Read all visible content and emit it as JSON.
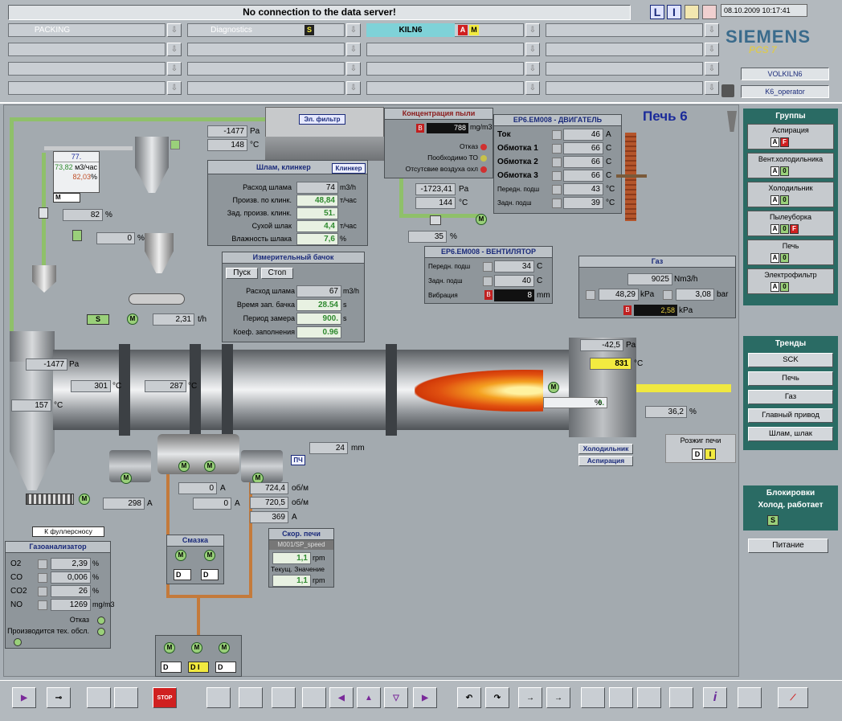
{
  "header": {
    "message": "No connection to the data server!",
    "datetime": "08.10.2009 10:17:41",
    "areas": [
      {
        "label": "PACKING"
      },
      {
        "label": "Diagnostics",
        "badge": "S"
      },
      {
        "label": "KILN6",
        "badges": [
          "A",
          "M"
        ]
      }
    ],
    "brand": "SIEMENS",
    "brand_sub": "PCS 7",
    "user1": "VOLKILN6",
    "user2": "K6_operator",
    "icons": [
      "L",
      "I"
    ]
  },
  "title": "Печь 6",
  "dust": {
    "title": "Концентрация пыли",
    "badge": "B",
    "value": "788",
    "unit": "mg/m3",
    "alarms": [
      "Отказ",
      "Пообходимо ТО",
      "Отсутсвие воздуха охл"
    ]
  },
  "filter": {
    "title": "Эл. фильтр",
    "pa": "-1477",
    "pa_unit": "Pa",
    "temp": "148",
    "temp_unit": "°C"
  },
  "fan_pre": {
    "pa": "-1723,41",
    "pa_unit": "Pa",
    "temp": "144",
    "temp_unit": "°C",
    "pct": "35",
    "pct_unit": "%"
  },
  "engine": {
    "title": "EP6.EM008 - ДВИГАТЕЛЬ",
    "rows": [
      {
        "label": "Ток",
        "value": "46",
        "unit": "A"
      },
      {
        "label": "Обмотка 1",
        "value": "66",
        "unit": "C"
      },
      {
        "label": "Обмотка 2",
        "value": "66",
        "unit": "C"
      },
      {
        "label": "Обмотка 3",
        "value": "66",
        "unit": "C"
      },
      {
        "label": "Передн. подш",
        "value": "43",
        "unit": "°C"
      },
      {
        "label": "Задн. подш",
        "value": "39",
        "unit": "°C"
      }
    ]
  },
  "slurry": {
    "title": "Шлам, клинкер",
    "btn": "Клинкер",
    "rows": [
      {
        "label": "Расход шлама",
        "value": "74",
        "unit": "m3/h"
      },
      {
        "label": "Произв. по клинк.",
        "value": "48,84",
        "unit": "т/час"
      },
      {
        "label": "Зад. произв. клинк.",
        "value": "51.",
        "unit": ""
      },
      {
        "label": "Сухой шлак",
        "value": "4,4",
        "unit": "т/час"
      },
      {
        "label": "Влажность шлака",
        "value": "7,6",
        "unit": "%"
      }
    ]
  },
  "feed": {
    "v1": "77.",
    "v2": "73,82",
    "v2_unit": "м3/час",
    "v3": "82,03",
    "v3_unit": "%",
    "mode": "M",
    "pct1": "82",
    "pct2": "0"
  },
  "measure": {
    "title": "Измерительный бачок",
    "start": "Пуск",
    "stop": "Стоп",
    "rows": [
      {
        "label": "Расход шлама",
        "value": "67",
        "unit": "m3/h"
      },
      {
        "label": "Время зап. бачка",
        "value": "28.54",
        "unit": "s"
      },
      {
        "label": "Период замера",
        "value": "900.",
        "unit": "s"
      },
      {
        "label": "Коеф. заполнения",
        "value": "0.96",
        "unit": ""
      }
    ]
  },
  "fan": {
    "title": "EP6.EM008 - ВЕНТИЛЯТОР",
    "rows": [
      {
        "label": "Передн. подш",
        "value": "34",
        "unit": "C"
      },
      {
        "label": "Задн. подш",
        "value": "40",
        "unit": "C"
      },
      {
        "label": "Вибрация",
        "value": "8",
        "unit": "mm",
        "badge": "B"
      }
    ]
  },
  "gas": {
    "title": "Газ",
    "flow": "9025",
    "flow_unit": "Nm3/h",
    "kpa": "48,29",
    "kpa_unit": "kPa",
    "bar": "3,08",
    "bar_unit": "bar",
    "badge": "B",
    "kpa2": "2,58",
    "kpa2_unit": "kPa"
  },
  "kiln": {
    "t_in": "-1477",
    "t_in_unit": "Pa",
    "t1": "301",
    "t2": "287",
    "tunit": "°C",
    "t3": "157",
    "pa_out": "-42,5",
    "pa_out_unit": "Pa",
    "t_out": "831",
    "t_out_unit": "°C",
    "flame_pct": "0.",
    "pct": "36,2",
    "mm": "24",
    "mm_unit": "mm",
    "feed": "2,31",
    "feed_unit": "t/h",
    "cooler": "Холодильник",
    "aspir": "Аспирация",
    "valve": "S"
  },
  "drive": {
    "rpm1": "724,4",
    "rpm2": "720,5",
    "rpm_unit": "об/м",
    "a1": "0",
    "a2": "0",
    "a3": "369",
    "a4": "298",
    "a_unit": "A",
    "pch": "ПЧ"
  },
  "ignite": {
    "title": "Розжиг печи",
    "d": "D",
    "i": "I"
  },
  "lube": {
    "title": "Смазка"
  },
  "speed": {
    "title": "Скор. печи",
    "tag": "M001/SP_speed",
    "sp": "1,1",
    "unit": "rpm",
    "cur_label": "Текущ. Значение",
    "cur": "1,1"
  },
  "pump_label": "К фуллерсносу",
  "gas_an": {
    "title": "Газоанализатор",
    "rows": [
      {
        "label": "O2",
        "value": "2,39",
        "unit": "%"
      },
      {
        "label": "CO",
        "value": "0,006",
        "unit": "%"
      },
      {
        "label": "CO2",
        "value": "26",
        "unit": "%"
      },
      {
        "label": "NO",
        "value": "1269",
        "unit": "mg/m3"
      }
    ],
    "a1": "Отказ",
    "a2": "Производится тех. обсл."
  },
  "groups": {
    "title": "Группы",
    "items": [
      {
        "label": "Аспирация",
        "flags": [
          "A",
          "F"
        ]
      },
      {
        "label": "Вент.холодильника",
        "flags": [
          "A",
          "0"
        ]
      },
      {
        "label": "Холодильник",
        "flags": [
          "A",
          "0"
        ]
      },
      {
        "label": "Пылеуборка",
        "flags": [
          "A",
          "0",
          "F"
        ]
      },
      {
        "label": "Печь",
        "flags": [
          "A",
          "0"
        ]
      },
      {
        "label": "Электрофильтр",
        "flags": [
          "A",
          "0"
        ]
      }
    ]
  },
  "trends": {
    "title": "Тренды",
    "items": [
      "SCK",
      "Печь",
      "Газ",
      "Главный привод",
      "Шлам, шлак"
    ]
  },
  "interlock": {
    "title": "Блокировки",
    "sub": "Холод. работает",
    "flag": "S"
  },
  "power": "Питание"
}
